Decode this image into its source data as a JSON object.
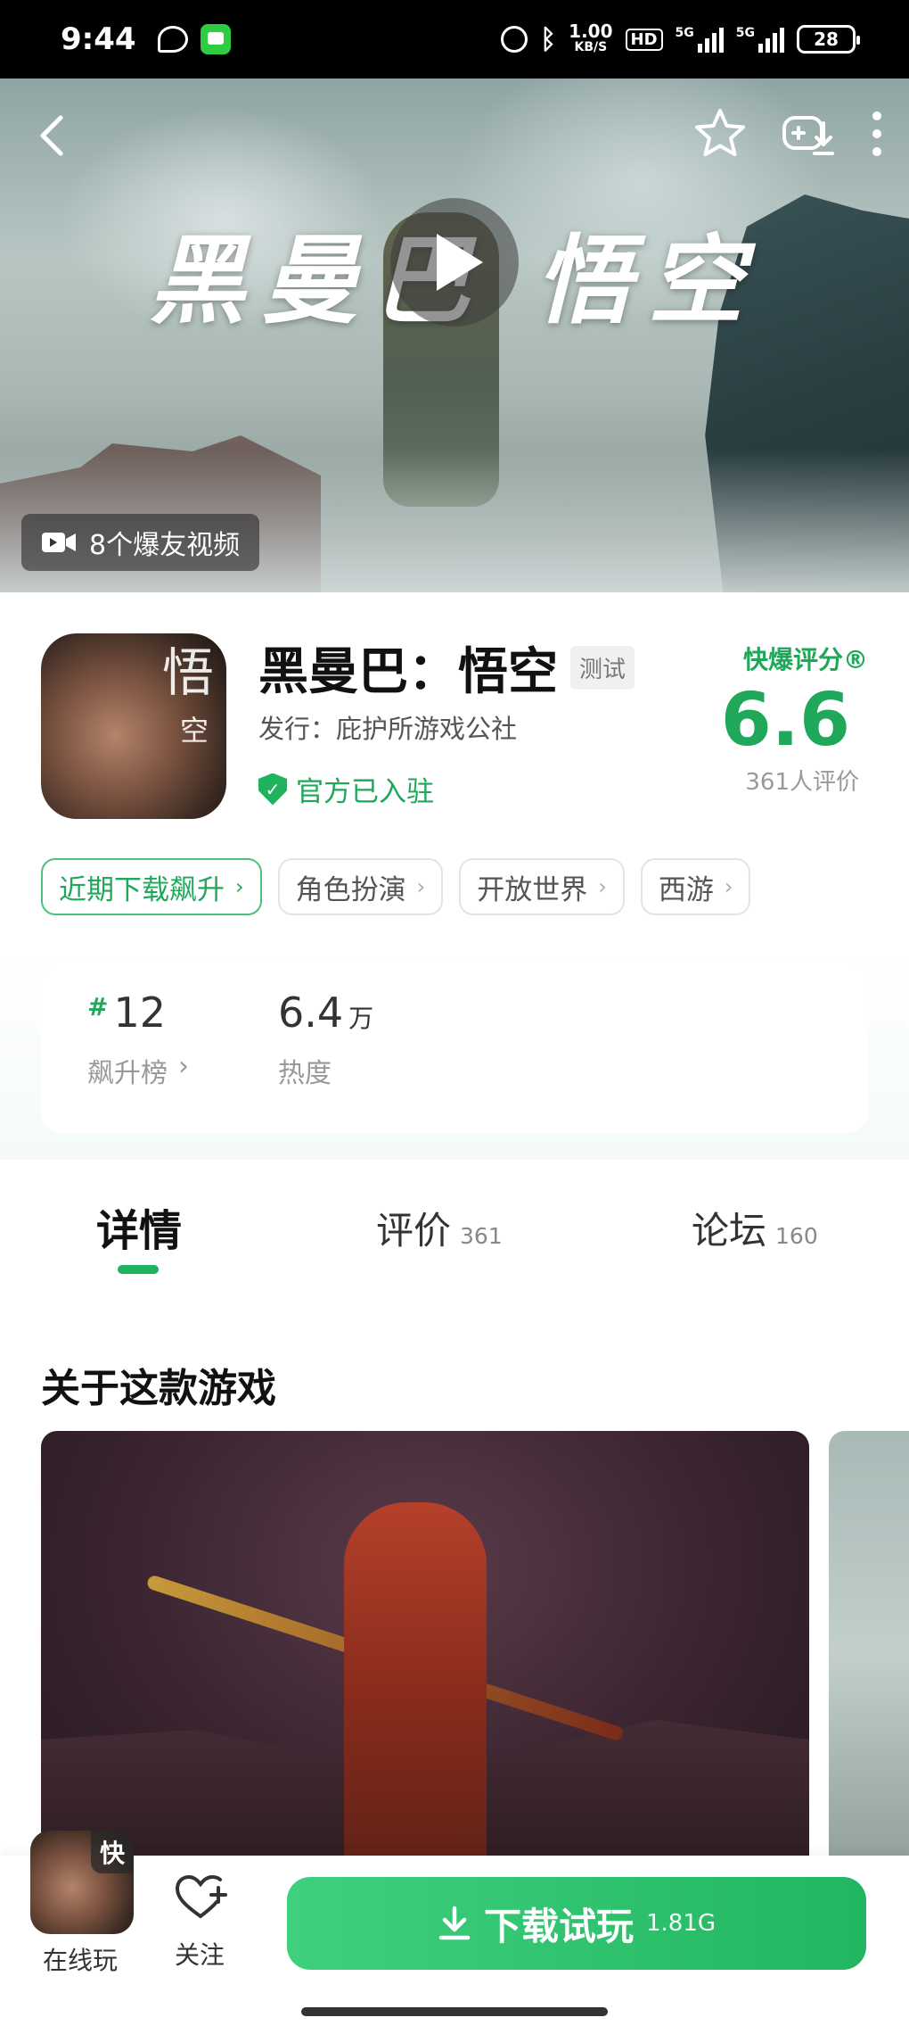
{
  "status_bar": {
    "time": "9:44",
    "speed_value": "1.00",
    "speed_unit": "KB/S",
    "hd": "HD",
    "net1": "5G",
    "net2": "5G",
    "battery": "28"
  },
  "banner": {
    "title": "黑曼巴 悟空",
    "video_badge": "8个爆友视频"
  },
  "app": {
    "name": "黑曼巴：悟空",
    "badge": "测试",
    "publisher": "发行：庇护所游戏公社",
    "official": "官方已入驻",
    "icon_glyph_1": "悟",
    "icon_glyph_2": "空"
  },
  "rating": {
    "label": "快爆评分®",
    "score": "6.6",
    "count": "361人评价"
  },
  "tags": [
    "近期下载飙升",
    "角色扮演",
    "开放世界",
    "西游"
  ],
  "stats": {
    "rank_hash": "#",
    "rank": "12",
    "rank_label": "飙升榜",
    "heat": "6.4",
    "heat_unit": "万",
    "heat_label": "热度"
  },
  "tabs": [
    {
      "label": "详情",
      "count": ""
    },
    {
      "label": "评价",
      "count": "361"
    },
    {
      "label": "论坛",
      "count": "160"
    }
  ],
  "section": {
    "title": "关于这款游戏"
  },
  "bottom": {
    "mini_corner": "快",
    "online_label": "在线玩",
    "follow_label": "关注",
    "download_label": "下载试玩",
    "download_size": "1.81G"
  },
  "colors": {
    "accent": "#1fb35e",
    "accent_text": "#1fa75a"
  }
}
